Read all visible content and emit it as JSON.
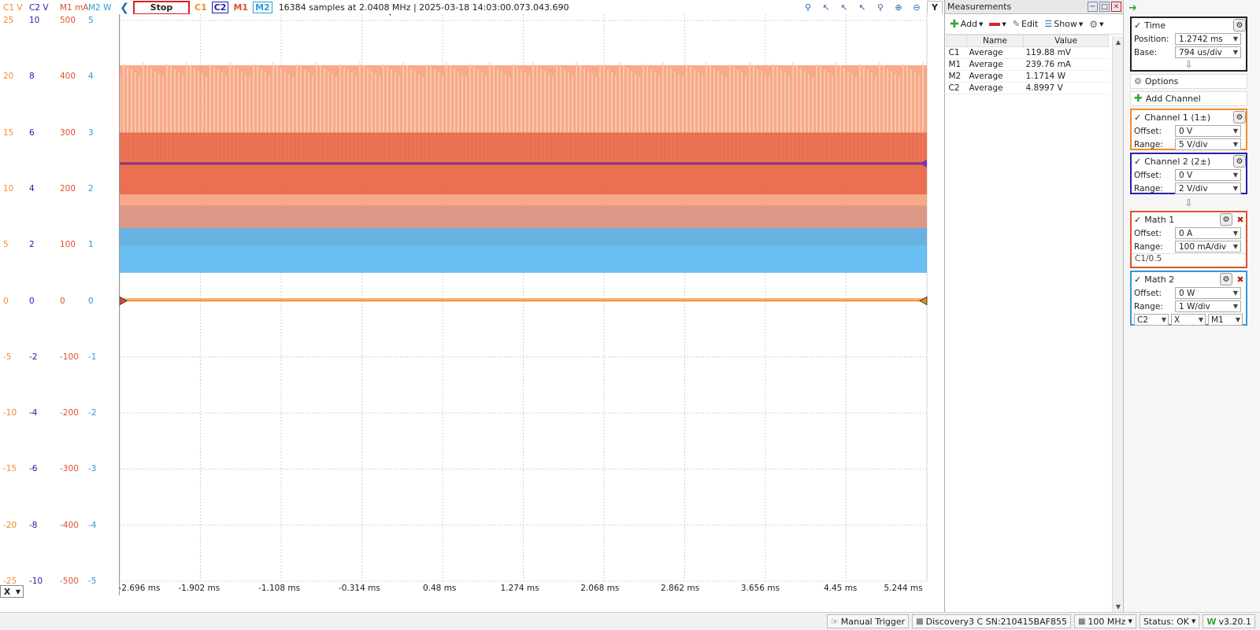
{
  "scales": {
    "c1": {
      "header": "C1 V",
      "color": "#f28c28",
      "ticks": [
        "25",
        "20",
        "15",
        "10",
        "5",
        "0",
        "-5",
        "-10",
        "-15",
        "-20",
        "-25"
      ]
    },
    "c2": {
      "header": "C2 V",
      "color": "#2222aa",
      "ticks": [
        "10",
        "8",
        "6",
        "4",
        "2",
        "0",
        "-2",
        "-4",
        "-6",
        "-8",
        "-10"
      ]
    },
    "m1": {
      "header": "M1 mA",
      "color": "#e05030",
      "ticks": [
        "500",
        "400",
        "300",
        "200",
        "100",
        "0",
        "-100",
        "-200",
        "-300",
        "-400",
        "-500"
      ]
    },
    "m2": {
      "header": "M2 W",
      "color": "#2f9ad8",
      "ticks": [
        "5",
        "4",
        "3",
        "2",
        "1",
        "0",
        "-1",
        "-2",
        "-3",
        "-4",
        "-5"
      ]
    }
  },
  "topbar": {
    "back_icon": "chevron-left-icon",
    "stop_label": "Stop",
    "channels": [
      {
        "label": "C1",
        "color": "#f28c28",
        "boxed": false
      },
      {
        "label": "C2",
        "color": "#2222aa",
        "boxed": true
      },
      {
        "label": "M1",
        "color": "#e05030",
        "boxed": false
      },
      {
        "label": "M2",
        "color": "#2f9ad8",
        "boxed": true
      }
    ],
    "status": "16384 samples at 2.0408 MHz | 2025-03-18 14:03:00.073.043.690",
    "tools": [
      "zoom-in-icon",
      "cursor-icon",
      "cursor-icon",
      "cursor-icon",
      "zoom-icon",
      "zoom-in-icon",
      "zoom-out-icon",
      "y-icon"
    ],
    "y_label": "Y"
  },
  "xaxis": {
    "ticks": [
      "-2.696 ms",
      "-1.902 ms",
      "-1.108 ms",
      "-0.314 ms",
      "0.48 ms",
      "1.274 ms",
      "2.068 ms",
      "2.862 ms",
      "3.656 ms",
      "4.45 ms",
      "5.244 ms"
    ]
  },
  "x_selector": {
    "label": "X"
  },
  "measurements": {
    "title": "Measurements",
    "tools": {
      "add": "Add",
      "remove_icon": "minus-icon",
      "edit": "Edit",
      "show": "Show",
      "gear_icon": "gear-icon"
    },
    "columns": [
      "",
      "Name",
      "Value"
    ],
    "rows": [
      {
        "ch": "C1",
        "name": "Average",
        "value": "119.88 mV"
      },
      {
        "ch": "M1",
        "name": "Average",
        "value": "239.76 mA"
      },
      {
        "ch": "M2",
        "name": "Average",
        "value": "1.1714 W"
      },
      {
        "ch": "C2",
        "name": "Average",
        "value": "4.8997 V"
      }
    ]
  },
  "control": {
    "time": {
      "title": "Time",
      "position_label": "Position:",
      "position": "1.2742 ms",
      "base_label": "Base:",
      "base": "794 us/div"
    },
    "options": "Options",
    "add_channel": "Add Channel",
    "channel1": {
      "title": "Channel 1 (1±)",
      "offset_label": "Offset:",
      "offset": "0 V",
      "range_label": "Range:",
      "range": "5 V/div",
      "color": "#f28c28"
    },
    "channel2": {
      "title": "Channel 2 (2±)",
      "offset_label": "Offset:",
      "offset": "0 V",
      "range_label": "Range:",
      "range": "2 V/div",
      "color": "#2222aa"
    },
    "math1": {
      "title": "Math 1",
      "offset_label": "Offset:",
      "offset": "0 A",
      "range_label": "Range:",
      "range": "100 mA/div",
      "expr": "C1/0.5",
      "color": "#e05030"
    },
    "math2": {
      "title": "Math 2",
      "offset_label": "Offset:",
      "offset": "0 W",
      "range_label": "Range:",
      "range": "1 W/div",
      "op_a": "C2",
      "op": "X",
      "op_b": "M1",
      "color": "#2f9ad8"
    }
  },
  "statusbar": {
    "manual_trigger": "Manual Trigger",
    "device": "Discovery3 C SN:210415BAF855",
    "freq": "100 MHz",
    "status": "Status: OK",
    "version": "v3.20.1"
  }
}
